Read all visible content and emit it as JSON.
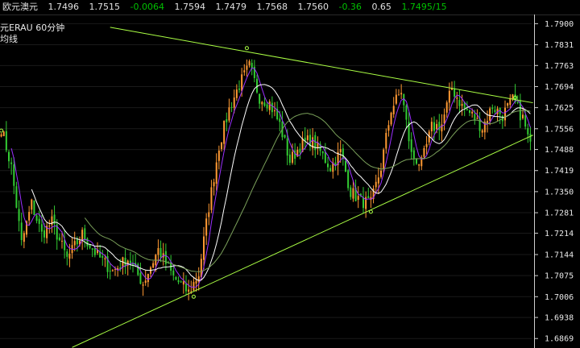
{
  "quote_bar": {
    "symbol": "欧元澳元",
    "last": "1.7496",
    "open": "1.7515",
    "change": "-0.0064",
    "high": "1.7594",
    "low": "1.7479",
    "v1": "1.7568",
    "v2": "1.7560",
    "change_pct": "-0.36",
    "v3": "0.65",
    "bid_ask": "1.7495/15"
  },
  "chart_title": {
    "symbol_period": "元ERAU   60分钟",
    "indicator": "均线"
  },
  "colors": {
    "background": "#000000",
    "candle_up": "#ff9933",
    "candle_down": "#33cc33",
    "ma_short": "#9b30ff",
    "ma_mid": "#ffffff",
    "ma_long": "#7aa05a",
    "trendline": "#aaff44",
    "axis_text": "#e8e8e8",
    "gridline": "#1a1a1a"
  },
  "chart_data": {
    "type": "candlestick",
    "y_axis_labels": [
      "1.7900",
      "1.7831",
      "1.7763",
      "1.7694",
      "1.7625",
      "1.7556",
      "1.7488",
      "1.7419",
      "1.7350",
      "1.7281",
      "1.7214",
      "1.7144",
      "1.7075",
      "1.7006",
      "1.6938",
      "1.6869"
    ],
    "ylim": [
      1.6838,
      1.793
    ],
    "x_count": 210,
    "price_path": [
      [
        0,
        1.756
      ],
      [
        4,
        1.743
      ],
      [
        8,
        1.718
      ],
      [
        12,
        1.731
      ],
      [
        16,
        1.721
      ],
      [
        20,
        1.725
      ],
      [
        26,
        1.713
      ],
      [
        32,
        1.721
      ],
      [
        38,
        1.714
      ],
      [
        44,
        1.709
      ],
      [
        50,
        1.713
      ],
      [
        56,
        1.705
      ],
      [
        62,
        1.716
      ],
      [
        68,
        1.707
      ],
      [
        74,
        1.702
      ],
      [
        78,
        1.708
      ],
      [
        82,
        1.73
      ],
      [
        86,
        1.75
      ],
      [
        90,
        1.762
      ],
      [
        94,
        1.77
      ],
      [
        98,
        1.776
      ],
      [
        102,
        1.766
      ],
      [
        106,
        1.764
      ],
      [
        110,
        1.757
      ],
      [
        114,
        1.745
      ],
      [
        118,
        1.75
      ],
      [
        122,
        1.752
      ],
      [
        126,
        1.748
      ],
      [
        130,
        1.743
      ],
      [
        134,
        1.748
      ],
      [
        138,
        1.735
      ],
      [
        142,
        1.732
      ],
      [
        146,
        1.731
      ],
      [
        150,
        1.743
      ],
      [
        154,
        1.762
      ],
      [
        158,
        1.768
      ],
      [
        162,
        1.747
      ],
      [
        166,
        1.744
      ],
      [
        170,
        1.756
      ],
      [
        174,
        1.757
      ],
      [
        178,
        1.769
      ],
      [
        182,
        1.763
      ],
      [
        186,
        1.76
      ],
      [
        190,
        1.756
      ],
      [
        194,
        1.763
      ],
      [
        198,
        1.76
      ],
      [
        202,
        1.765
      ],
      [
        206,
        1.759
      ],
      [
        209,
        1.7496
      ]
    ],
    "pivots": [
      {
        "i": 0,
        "v": 1.755
      },
      {
        "i": 97,
        "v": 1.782
      },
      {
        "i": 76,
        "v": 1.7006
      },
      {
        "i": 146,
        "v": 1.7284
      },
      {
        "i": 203,
        "v": 1.7658
      }
    ],
    "trendlines": [
      {
        "name": "resistance",
        "from": [
          43,
          1.7888
        ],
        "to": [
          210,
          1.7641
        ]
      },
      {
        "name": "support",
        "from": [
          28,
          1.684
        ],
        "to": [
          210,
          1.7535
        ]
      }
    ],
    "moving_averages": [
      {
        "period": 5,
        "color_key": "ma_short"
      },
      {
        "period": 13,
        "color_key": "ma_mid"
      },
      {
        "period": 34,
        "color_key": "ma_long"
      }
    ]
  }
}
